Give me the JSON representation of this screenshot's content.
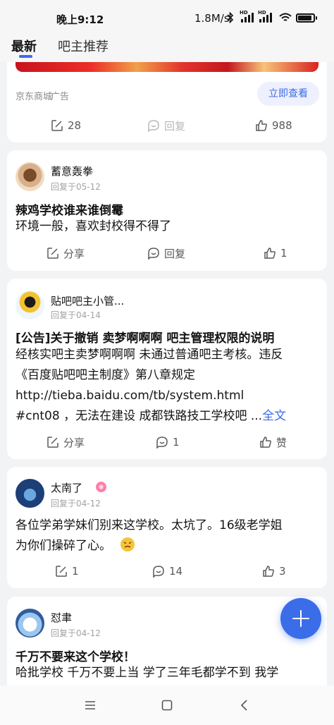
{
  "status_bar": {
    "time": "晚上9:12",
    "network_speed": "1.8M/s",
    "sim1_tag": "HD",
    "sim2_tag": "HD"
  },
  "tabs": {
    "latest": "最新",
    "recommended": "吧主推荐"
  },
  "ad": {
    "source": "京东商城",
    "tag": "广告",
    "cta": "立即查看",
    "share_count": "28",
    "reply_label": "回复",
    "like_count": "988"
  },
  "posts": [
    {
      "user": "蓄意轰拳",
      "meta": "回复于05-12",
      "title": "辣鸡学校谁来谁倒霉",
      "body_lines": [
        "环境一般，喜欢封校得不得了"
      ],
      "share": "分享",
      "reply": "回复",
      "like": "1"
    },
    {
      "user": "贴吧吧主小管...",
      "meta": "回复于04-14",
      "title": "[公告]关于撤销 卖梦啊啊啊 吧主管理权限的说明",
      "body_lines": [
        "经核实吧主卖梦啊啊啊 未通过普通吧主考核。违反",
        "《百度贴吧吧主制度》第八章规定",
        "http://tieba.baidu.com/tb/system.html",
        "#cnt08 ，无法在建设 成都铁路技工学校吧 ..."
      ],
      "more": "全文",
      "share": "分享",
      "reply": "1",
      "like": "赞"
    },
    {
      "user": "太南了",
      "meta": "回复于04-12",
      "title": "",
      "body_lines": [
        "各位学弟学妹们别来这学校。太坑了。16级老学姐",
        "为你们操碎了心。"
      ],
      "share": "1",
      "reply": "14",
      "like": "3"
    },
    {
      "user": "怼聿",
      "meta": "回复于04-12",
      "title": "千万不要来这个学校！",
      "body_lines": [
        "哈批学校 千万不要上当 学了三年毛都学不到 我学"
      ]
    }
  ],
  "colors": {
    "accent": "#3b6de9",
    "background": "#f2f3f5",
    "card": "#ffffff"
  },
  "icons": [
    "bluetooth-icon",
    "signal-icon",
    "wifi-icon",
    "battery-icon",
    "share-icon",
    "reply-icon",
    "like-icon",
    "add-icon",
    "menu-icon",
    "home-icon",
    "back-icon"
  ]
}
